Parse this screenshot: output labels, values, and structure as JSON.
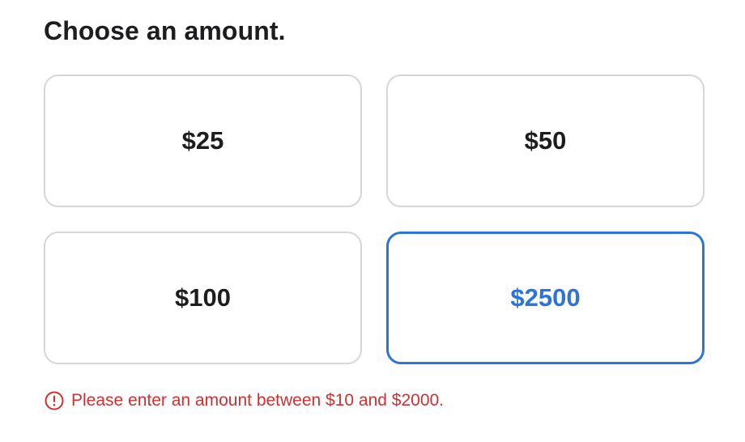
{
  "heading": "Choose an amount.",
  "amounts": [
    {
      "label": "$25",
      "selected": false
    },
    {
      "label": "$50",
      "selected": false
    },
    {
      "label": "$100",
      "selected": false
    },
    {
      "label": "$2500",
      "selected": true
    }
  ],
  "error": {
    "icon": "alert-circle-icon",
    "message": "Please enter an amount between $10 and $2000."
  },
  "colors": {
    "selected_accent": "#2e73dc",
    "error": "#d32f2f",
    "border": "#d6d6d6",
    "text": "#1d1d1f"
  }
}
